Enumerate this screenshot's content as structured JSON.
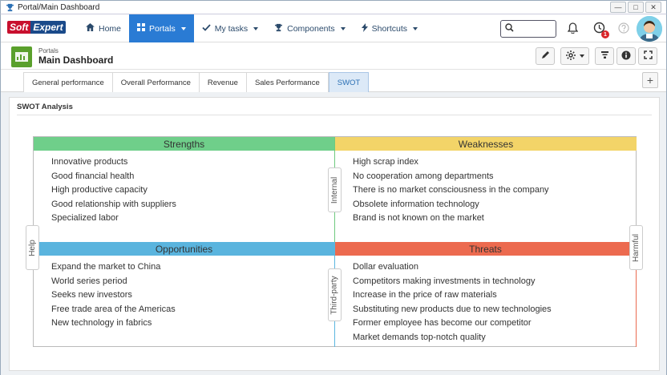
{
  "window": {
    "title": "Portal/Main Dashboard",
    "controls": [
      "—",
      "□",
      "✕"
    ]
  },
  "brand": {
    "part1": "Soft",
    "part2": "Expert"
  },
  "nav": {
    "items": [
      {
        "label": "Home",
        "icon": "home-icon",
        "active": false
      },
      {
        "label": "Portals",
        "icon": "grid-icon",
        "active": true
      },
      {
        "label": "My tasks",
        "icon": "check-icon",
        "active": false
      },
      {
        "label": "Components",
        "icon": "trophy-icon",
        "active": false
      },
      {
        "label": "Shortcuts",
        "icon": "bolt-icon",
        "active": false
      }
    ],
    "search_placeholder": "",
    "notification_badge": "1"
  },
  "header": {
    "breadcrumb": "Portals",
    "title": "Main Dashboard"
  },
  "tabs": [
    {
      "label": "General performance",
      "active": false
    },
    {
      "label": "Overall Performance",
      "active": false
    },
    {
      "label": "Revenue",
      "active": false
    },
    {
      "label": "Sales Performance",
      "active": false
    },
    {
      "label": "SWOT",
      "active": true
    }
  ],
  "panel": {
    "title": "SWOT Analysis"
  },
  "swot": {
    "axis": {
      "top_middle": "Internal",
      "bottom_middle": "Third-party",
      "left": "Help",
      "right": "Harmful"
    },
    "strengths": {
      "title": "Strengths",
      "color": "#6fcf8a",
      "items": [
        "Innovative products",
        "Good financial health",
        "High productive capacity",
        "Good relationship with suppliers",
        "Specialized labor"
      ]
    },
    "weaknesses": {
      "title": "Weaknesses",
      "color": "#f3d468",
      "items": [
        "High scrap index",
        "No cooperation among departments",
        "There is no market consciousness in the company",
        "Obsolete information technology",
        "Brand is not known on the market"
      ]
    },
    "opportunities": {
      "title": "Opportunities",
      "color": "#5ab4de",
      "items": [
        "Expand the market to China",
        "World series period",
        "Seeks new investors",
        "Free trade area of the Americas",
        "New technology in fabrics"
      ]
    },
    "threats": {
      "title": "Threats",
      "color": "#ec6a4f",
      "items": [
        "Dollar evaluation",
        "Competitors making investments in technology",
        "Increase in the price of raw materials",
        "Substituting new products due to new technologies",
        "Former employee has become our competitor",
        "Market demands top-notch quality"
      ]
    }
  }
}
